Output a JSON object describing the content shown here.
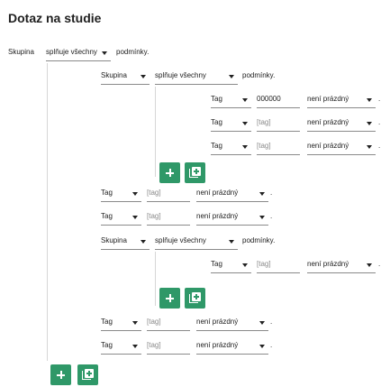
{
  "title": "Dotaz na studie",
  "labels": {
    "group": "Skupina",
    "tag": "Tag",
    "fulfills_all": "splňuje všechny",
    "conditions": "podmínky.",
    "not_empty": "není prázdný",
    "tag_placeholder": "[tag]",
    "tag_value_1": "000000",
    "period": "."
  },
  "icons": {
    "add": "plus-icon",
    "add_group": "library-add-icon",
    "dropdown": "caret-down-icon"
  },
  "colors": {
    "accent": "#2f9868"
  }
}
